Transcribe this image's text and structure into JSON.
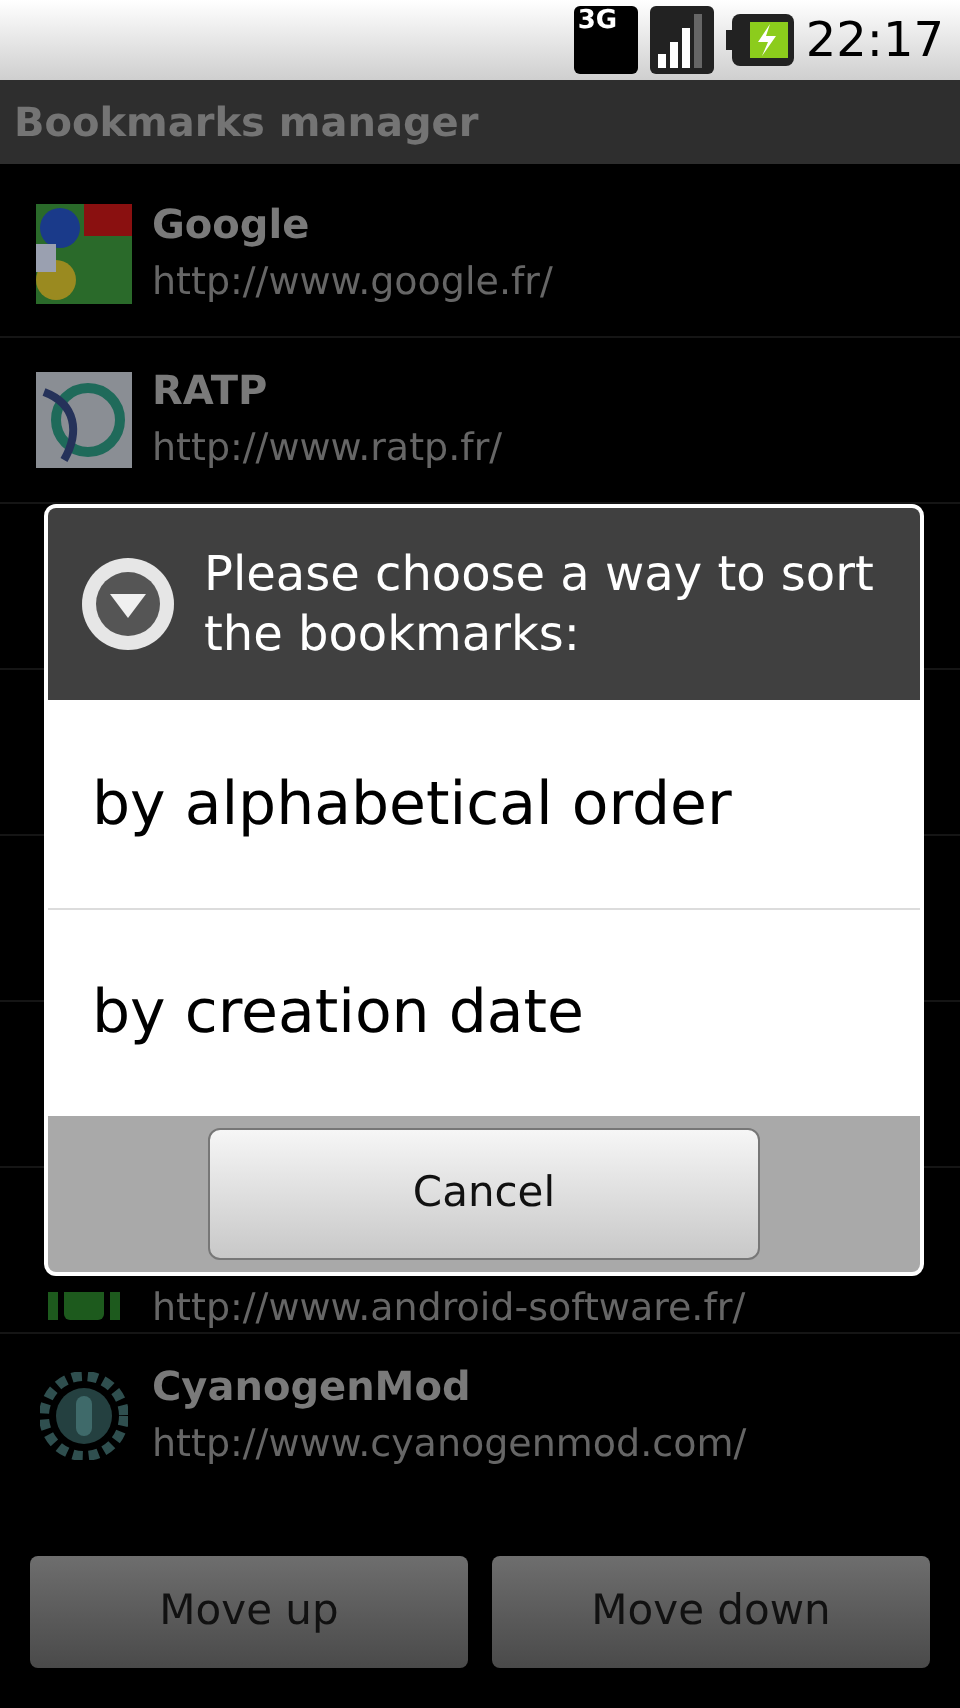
{
  "status_bar": {
    "network": "3G",
    "time": "22:17"
  },
  "title": "Bookmarks manager",
  "bookmarks": [
    {
      "kind": "google",
      "name": "Google",
      "url": "http://www.google.fr/"
    },
    {
      "kind": "ratp",
      "name": "RATP",
      "url": "http://www.ratp.fr/"
    },
    {
      "kind": "hidden"
    },
    {
      "kind": "hidden"
    },
    {
      "kind": "hidden"
    },
    {
      "kind": "hidden"
    },
    {
      "kind": "android",
      "url": "http://www.android-software.fr/"
    },
    {
      "kind": "cyanogen",
      "name": "CyanogenMod",
      "url": "http://www.cyanogenmod.com/"
    }
  ],
  "dialog": {
    "title": "Please choose a way to sort the bookmarks:",
    "options": [
      {
        "label": "by alphabetical order"
      },
      {
        "label": "by creation date"
      }
    ],
    "button": "Cancel"
  },
  "buttons": [
    "Move up",
    "Move down"
  ]
}
